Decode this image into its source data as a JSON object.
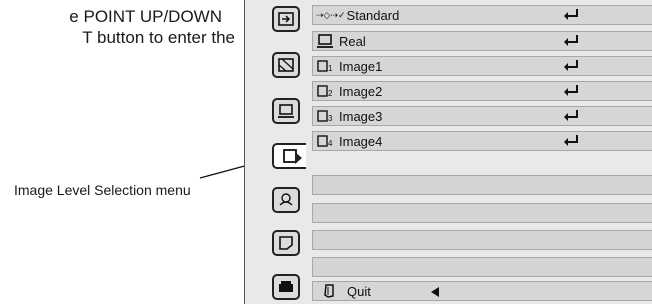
{
  "intro": {
    "line1": "e POINT UP/DOWN",
    "line2": "T button to enter the"
  },
  "callout": {
    "label": "Image Level Selection menu"
  },
  "sidebar": {
    "icons": [
      {
        "name": "input-icon"
      },
      {
        "name": "image-adjust-icon"
      },
      {
        "name": "screen-icon"
      },
      {
        "name": "image-select-icon",
        "selected": true
      },
      {
        "name": "setting-icon"
      },
      {
        "name": "pc-adjust-icon"
      },
      {
        "name": "projector-icon"
      }
    ]
  },
  "menu": {
    "rows": [
      {
        "label": "Standard",
        "prefix": "⇢◇⇢✓",
        "icon": "standard-icon",
        "enter": true
      },
      {
        "label": "Real",
        "icon": "real-icon",
        "enter": true
      },
      {
        "label": "Image1",
        "icon": "image1-icon",
        "number": "1",
        "enter": true
      },
      {
        "label": "Image2",
        "icon": "image2-icon",
        "number": "2",
        "enter": true
      },
      {
        "label": "Image3",
        "icon": "image3-icon",
        "number": "3",
        "enter": true
      },
      {
        "label": "Image4",
        "icon": "image4-icon",
        "number": "4",
        "enter": true
      }
    ],
    "quit_label": "Quit"
  }
}
